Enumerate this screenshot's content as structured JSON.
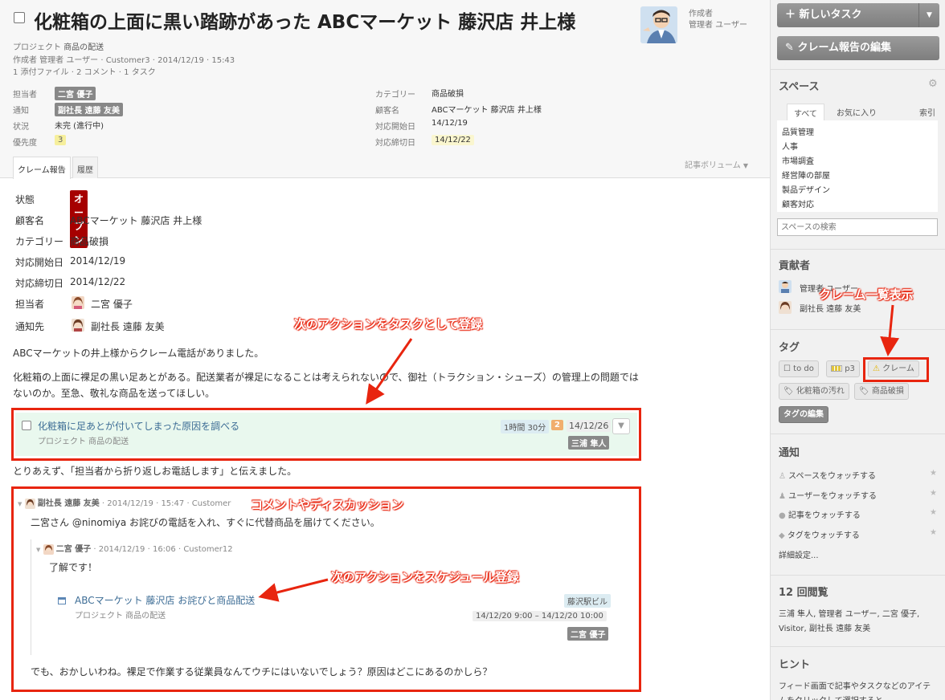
{
  "post": {
    "title": "化粧箱の上面に黒い踏跡があった ABCマーケット 藤沢店 井上様",
    "project_label": "プロジェクト",
    "project": "商品の配送",
    "byline": "作成者 管理者 ユーザー · Customer3 · 2014/12/19 · 15:43",
    "stats": "1 添付ファイル · 2 コメント · 1 タスク",
    "author_label": "作成者",
    "author_name": "管理者 ユーザー"
  },
  "props_left": [
    {
      "key": "担当者",
      "value": "二宮 優子",
      "style": "tag"
    },
    {
      "key": "通知",
      "value": "副社長 遠藤 友美",
      "style": "tag"
    },
    {
      "key": "状況",
      "value": "未完 (進行中)",
      "style": "text"
    },
    {
      "key": "優先度",
      "value": "3",
      "style": "prio"
    }
  ],
  "props_right": [
    {
      "key": "カテゴリー",
      "value": "商品破損",
      "style": "text"
    },
    {
      "key": "顧客名",
      "value": "ABCマーケット 藤沢店 井上様",
      "style": "text"
    },
    {
      "key": "対応開始日",
      "value": "14/12/19",
      "style": "text"
    },
    {
      "key": "対応締切日",
      "value": "14/12/22",
      "style": "date"
    }
  ],
  "tabs": [
    "クレーム報告",
    "履歴"
  ],
  "volume_label": "記事ボリューム",
  "detail": [
    {
      "key": "状態",
      "value": "オープン"
    },
    {
      "key": "顧客名",
      "value": "ABCマーケット 藤沢店 井上様"
    },
    {
      "key": "カテゴリー",
      "value": "商品破損"
    },
    {
      "key": "対応開始日",
      "value": "2014/12/19"
    },
    {
      "key": "対応締切日",
      "value": "2014/12/22"
    },
    {
      "key": "担当者",
      "value": "二宮 優子"
    },
    {
      "key": "通知先",
      "value": "副社長 遠藤 友美"
    }
  ],
  "body": {
    "p1": "ABCマーケットの井上様からクレーム電話がありました。",
    "p2a": "化粧箱の上面に裸足の黒い足あとがある。配送業者が裸足になることは考えられないので、御社（トラクション・シューズ）の管理上の問題では",
    "p2b": "ないのか。至急、敬礼な商品を送ってほしい。",
    "p3": "とりあえず、「担当者から折り返しお電話します」と伝えました。"
  },
  "task": {
    "title": "化粧箱に足あとが付いてしまった原因を調べる",
    "project": "プロジェクト 商品の配送",
    "time": "1時間 30分",
    "count": "2",
    "date": "14/12/26",
    "owner": "三浦 隼人"
  },
  "comment1": {
    "author": "副社長 遠藤 友美",
    "meta": " · 2014/12/19 · 15:47 · Customer",
    "text": "二宮さん @ninomiya お詫びの電話を入れ、すぐに代替商品を届けてください。"
  },
  "comment2": {
    "author": "二宮 優子",
    "meta": " · 2014/12/19 · 16:06 · Customer12",
    "text": "了解です！"
  },
  "schedule": {
    "title": "ABCマーケット 藤沢店 お詫びと商品配送",
    "project": "プロジェクト 商品の配送",
    "place": "藤沢駅ビル",
    "time": "14/12/20 9:00 – 14/12/20 10:00",
    "owner": "二宮 優子"
  },
  "comment3_text": "でも、おかしいわね。裸足で作業する従業員なんてウチにはいないでしょう？原因はどこにあるのかしら？",
  "callouts": {
    "task": "次のアクションをタスクとして登録",
    "comment": "コメントやディスカッション",
    "schedule": "次のアクションをスケジュール登録",
    "claim": "クレーム一覧表示"
  },
  "sidebar": {
    "new_task": "新しいタスク",
    "edit_report": "クレーム報告の編集",
    "spaces_title": "スペース",
    "space_tabs": [
      "すべて",
      "お気に入り",
      "索引"
    ],
    "spaces": [
      "品質管理",
      "人事",
      "市場調査",
      "経営陣の部屋",
      "製品デザイン",
      "顧客対応"
    ],
    "space_search": "スペースの検索",
    "contributors_title": "貢献者",
    "contributors": [
      "管理者 ユーザー",
      "副社長 遠藤 友美"
    ],
    "tags_title": "タグ",
    "tags_row1": [
      "to do",
      "p3",
      "クレーム"
    ],
    "tags_row2": [
      "化粧箱の汚れ",
      "商品破損"
    ],
    "edit_tags": "タグの編集",
    "notify_title": "通知",
    "notify": [
      "スペースをウォッチする",
      "ユーザーをウォッチする",
      "記事をウォッチする",
      "タグをウォッチする"
    ],
    "notify_more": "詳細設定...",
    "views_title": "12 回閲覧",
    "views_line1": "三浦 隼人, 管理者 ユーザー, 二宮 優子,",
    "views_line2": "Visitor, 副社長 遠藤 友美",
    "hint_title": "ヒント",
    "hint_text": "フィード画面で記事やタスクなどのアイテ",
    "hint_text2": "ムをクリックして選択すると..."
  }
}
